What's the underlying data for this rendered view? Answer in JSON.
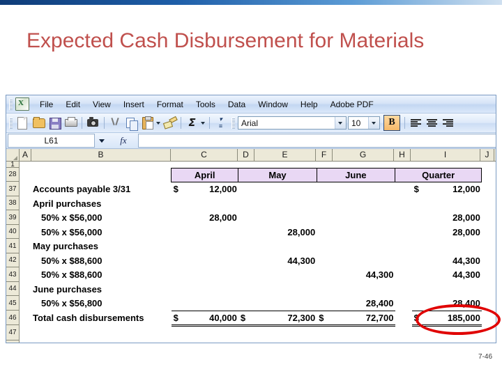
{
  "slide": {
    "title": "Expected Cash Disbursement for Materials",
    "page_number": "7-46",
    "title_color": "#c0504d"
  },
  "excel": {
    "menu": [
      {
        "label": "File"
      },
      {
        "label": "Edit"
      },
      {
        "label": "View"
      },
      {
        "label": "Insert"
      },
      {
        "label": "Format"
      },
      {
        "label": "Tools"
      },
      {
        "label": "Data"
      },
      {
        "label": "Window"
      },
      {
        "label": "Help"
      },
      {
        "label": "Adobe PDF"
      }
    ],
    "toolbar": {
      "icons": [
        "new-icon",
        "open-icon",
        "save-icon",
        "print-icon",
        "camera-icon",
        "cut-icon",
        "copy-icon",
        "paste-icon",
        "format-painter-icon",
        "autosum-icon",
        "sort-icon"
      ],
      "font_name": "Arial",
      "font_size": "10",
      "bold_label": "B",
      "bold_active": true,
      "align_buttons": [
        "align-left-icon",
        "align-center-icon",
        "align-right-icon"
      ]
    },
    "formula_bar": {
      "name_box_value": "L61",
      "fx_label": "fx",
      "formula_value": ""
    },
    "columns": [
      "A",
      "B",
      "C",
      "D",
      "E",
      "F",
      "G",
      "H",
      "I",
      "J"
    ],
    "rows": [
      "1",
      "28",
      "37",
      "38",
      "39",
      "40",
      "41",
      "42",
      "43",
      "44",
      "45",
      "46",
      "47"
    ],
    "col_headers": {
      "april": "April",
      "may": "May",
      "june": "June",
      "quarter": "Quarter"
    },
    "sheet_rows": [
      {
        "row": "37",
        "label": "Accounts payable 3/31",
        "indent": false,
        "april_cur": "$",
        "april": "12,000",
        "may_cur": "",
        "may": "",
        "june_cur": "",
        "june": "",
        "quarter_cur": "$",
        "quarter": "12,000"
      },
      {
        "row": "38",
        "label": "April purchases",
        "indent": false,
        "april_cur": "",
        "april": "",
        "may_cur": "",
        "may": "",
        "june_cur": "",
        "june": "",
        "quarter_cur": "",
        "quarter": ""
      },
      {
        "row": "39",
        "label": "50% x $56,000",
        "indent": true,
        "april_cur": "",
        "april": "28,000",
        "may_cur": "",
        "may": "",
        "june_cur": "",
        "june": "",
        "quarter_cur": "",
        "quarter": "28,000"
      },
      {
        "row": "40",
        "label": "50% x $56,000",
        "indent": true,
        "april_cur": "",
        "april": "",
        "may_cur": "",
        "may": "28,000",
        "june_cur": "",
        "june": "",
        "quarter_cur": "",
        "quarter": "28,000"
      },
      {
        "row": "41",
        "label": "May purchases",
        "indent": false,
        "april_cur": "",
        "april": "",
        "may_cur": "",
        "may": "",
        "june_cur": "",
        "june": "",
        "quarter_cur": "",
        "quarter": ""
      },
      {
        "row": "42",
        "label": "50% x $88,600",
        "indent": true,
        "april_cur": "",
        "april": "",
        "may_cur": "",
        "may": "44,300",
        "june_cur": "",
        "june": "",
        "quarter_cur": "",
        "quarter": "44,300"
      },
      {
        "row": "43",
        "label": "50% x $88,600",
        "indent": true,
        "april_cur": "",
        "april": "",
        "may_cur": "",
        "may": "",
        "june_cur": "",
        "june": "44,300",
        "quarter_cur": "",
        "quarter": "44,300"
      },
      {
        "row": "44",
        "label": "June purchases",
        "indent": false,
        "april_cur": "",
        "april": "",
        "may_cur": "",
        "may": "",
        "june_cur": "",
        "june": "",
        "quarter_cur": "",
        "quarter": ""
      },
      {
        "row": "45",
        "label": "50% x $56,800",
        "indent": true,
        "april_cur": "",
        "april": "",
        "may_cur": "",
        "may": "",
        "june_cur": "",
        "june": "28,400",
        "quarter_cur": "",
        "quarter": "28,400"
      },
      {
        "row": "46",
        "label": "Total cash disbursements",
        "indent": false,
        "april_cur": "$",
        "april": "40,000",
        "may_cur": "$",
        "may": "72,300",
        "june_cur": "$",
        "june": "72,700",
        "quarter_cur": "$",
        "quarter": "185,000"
      }
    ],
    "annotation": {
      "shape": "red-oval-highlight",
      "color": "#e00000",
      "highlighted_value": "28,400"
    }
  }
}
